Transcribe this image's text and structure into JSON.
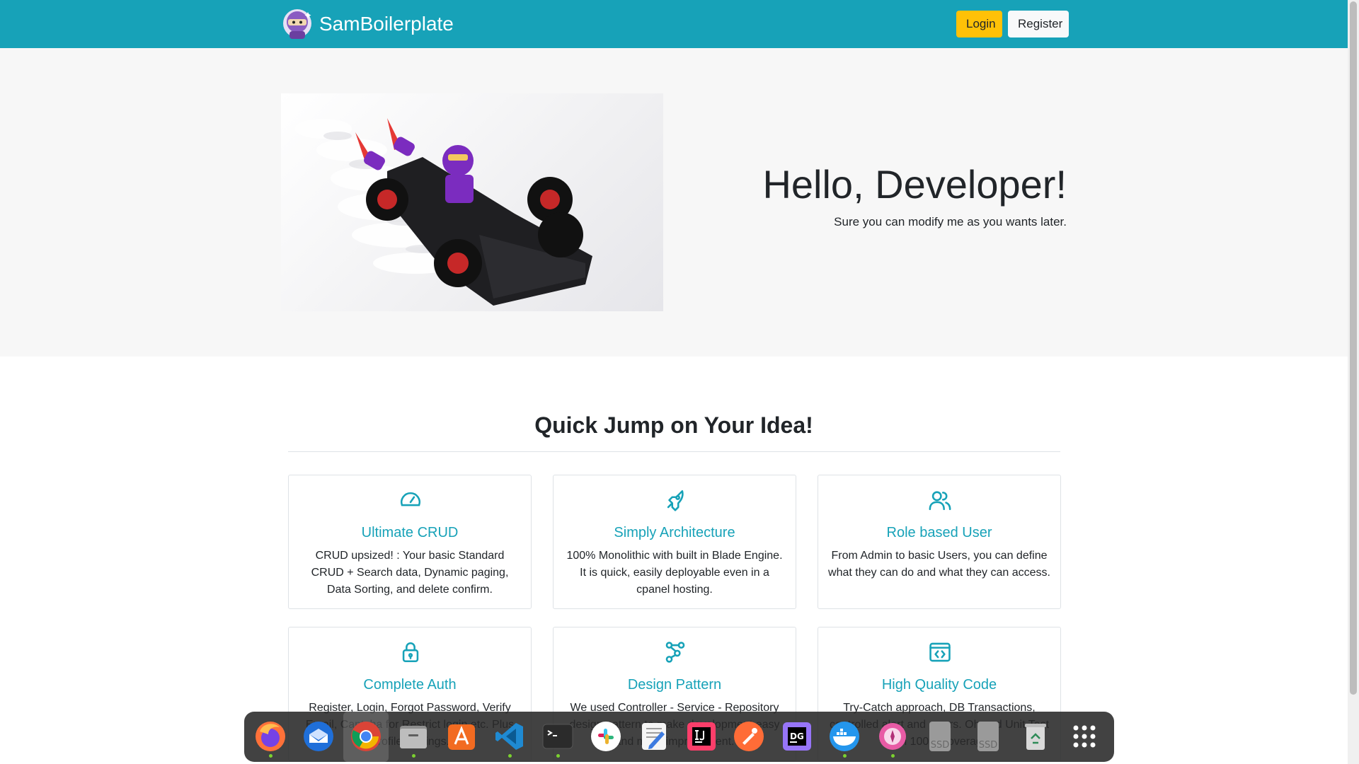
{
  "navbar": {
    "brand": "SamBoilerplate",
    "login_label": "Login",
    "register_label": "Register",
    "bg_color": "#17a2b8"
  },
  "hero": {
    "title": "Hello, Developer!",
    "subtitle": "Sure you can modify me as you wants later."
  },
  "features": {
    "heading": "Quick Jump on Your Idea!",
    "cards": [
      {
        "icon": "speedometer-icon",
        "title": "Ultimate CRUD",
        "text": "CRUD upsized! : Your basic Standard CRUD + Search data, Dynamic paging, Data Sorting, and delete confirm."
      },
      {
        "icon": "rocket-icon",
        "title": "Simply Architecture",
        "text": "100% Monolithic with built in Blade Engine. It is quick, easily deployable even in a cpanel hosting."
      },
      {
        "icon": "users-icon",
        "title": "Role based User",
        "text": "From Admin to basic Users, you can define what they can do and what they can access."
      },
      {
        "icon": "lock-icon",
        "title": "Complete Auth",
        "text": "Register, Login, Forgot Password, Verify Email, Captcha for Restrict login etc. Plus Profile Settings."
      },
      {
        "icon": "share-nodes-icon",
        "title": "Design Pattern",
        "text": "We used Controller - Service - Repository design pattern to make development easy and more improvement."
      },
      {
        "icon": "code-window-icon",
        "title": "High Quality Code",
        "text": "Try-Catch approach, DB Transactions, controlled alert and errors. Oh and Unit Test with 100% coverage."
      }
    ]
  },
  "dock": {
    "apps": [
      "firefox-icon",
      "thunderbird-icon",
      "chrome-icon",
      "files-icon",
      "app-store-icon",
      "vscode-icon",
      "terminal-icon",
      "slack-icon",
      "text-editor-icon",
      "intellij-icon",
      "postman-icon",
      "datagrip-icon",
      "docker-icon",
      "compass-icon",
      "ssd-drive-icon",
      "ssd-drive-icon",
      "trash-icon",
      "app-grid-icon"
    ],
    "ssd_label_1": "SSD",
    "ssd_label_2": "SSD"
  }
}
